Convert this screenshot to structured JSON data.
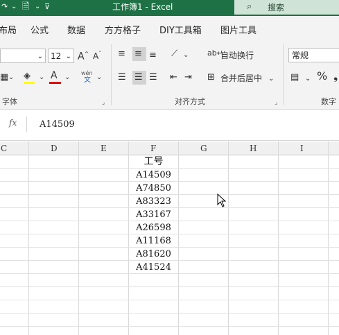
{
  "titlebar": {
    "title": "工作簿1  -  Excel",
    "search_label": "搜索"
  },
  "tabs": [
    "布局",
    "公式",
    "数据",
    "方方格子",
    "DIY工具箱",
    "图片工具"
  ],
  "ribbon": {
    "font_size": "12",
    "wrap_text": "自动换行",
    "merge_center": "合并后居中",
    "number_format": "常规",
    "group_font": "字体",
    "group_alignment": "对齐方式",
    "group_number": "数字",
    "percent": "%",
    "pinyin": "wén"
  },
  "formula_bar": {
    "fx": "fx",
    "value": "A14509"
  },
  "columns": [
    "C",
    "D",
    "E",
    "F",
    "G",
    "H",
    "I"
  ],
  "column_f": {
    "header": "工号",
    "values": [
      "A14509",
      "A74850",
      "A83323",
      "A33167",
      "A26598",
      "A11168",
      "A81620",
      "A41524"
    ]
  }
}
